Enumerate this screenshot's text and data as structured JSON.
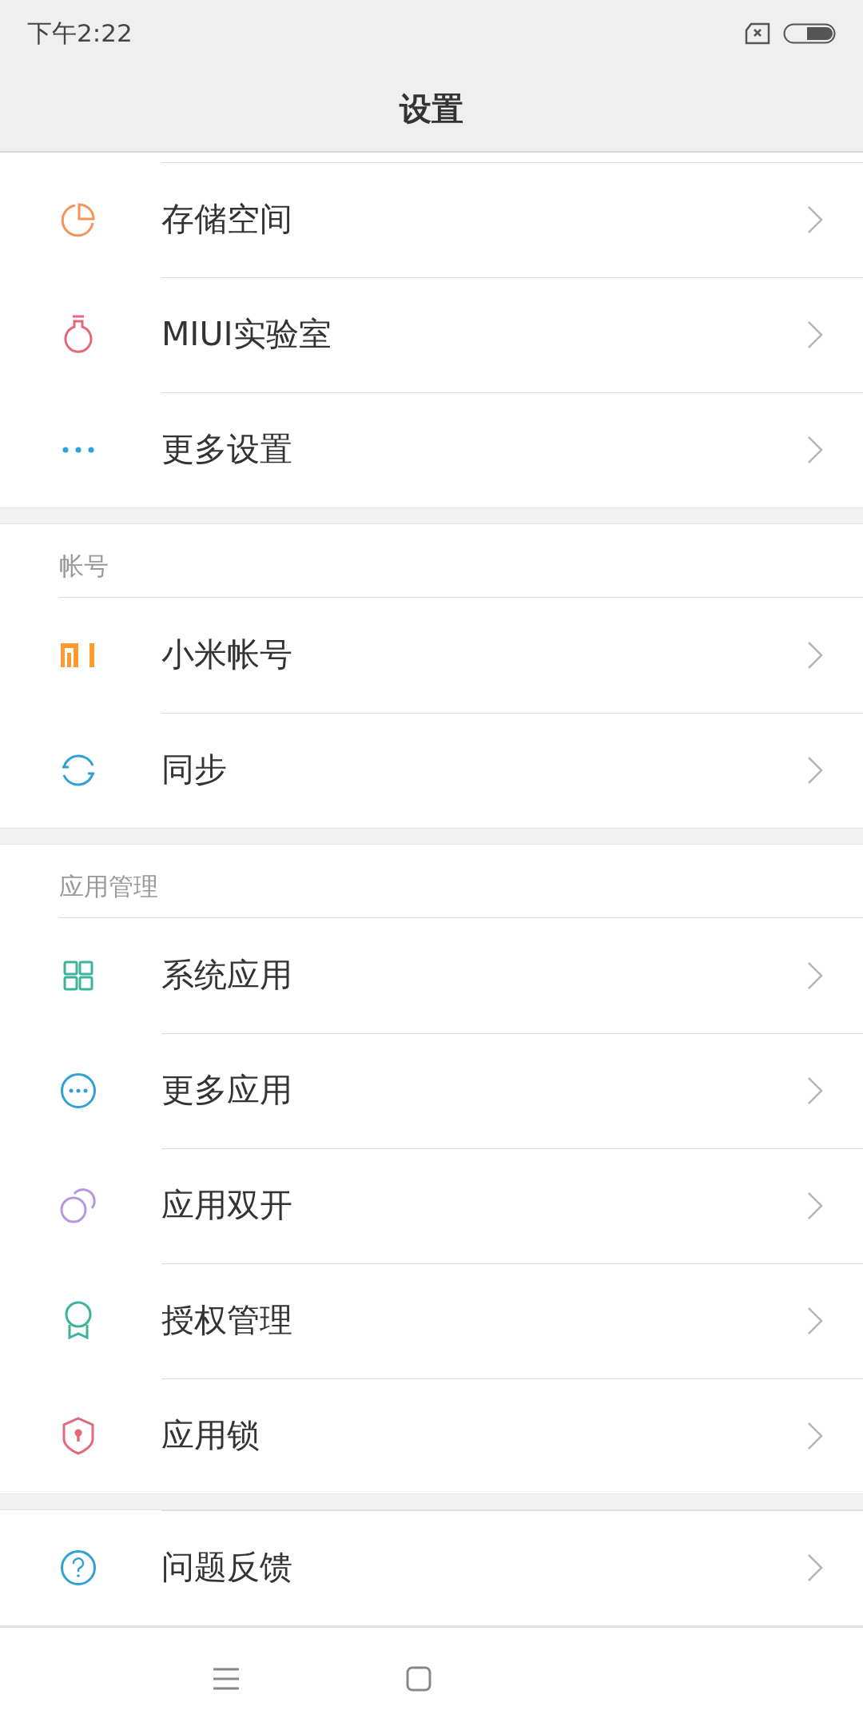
{
  "status_bar": {
    "time": "下午2:22"
  },
  "title": "设置",
  "groups": [
    {
      "items": [
        {
          "label": "存储空间"
        },
        {
          "label": "MIUI实验室"
        },
        {
          "label": "更多设置"
        }
      ]
    },
    {
      "header": "帐号",
      "items": [
        {
          "label": "小米帐号"
        },
        {
          "label": "同步"
        }
      ]
    },
    {
      "header": "应用管理",
      "items": [
        {
          "label": "系统应用"
        },
        {
          "label": "更多应用"
        },
        {
          "label": "应用双开"
        },
        {
          "label": "授权管理"
        },
        {
          "label": "应用锁"
        }
      ]
    },
    {
      "items": [
        {
          "label": "问题反馈"
        }
      ]
    }
  ]
}
